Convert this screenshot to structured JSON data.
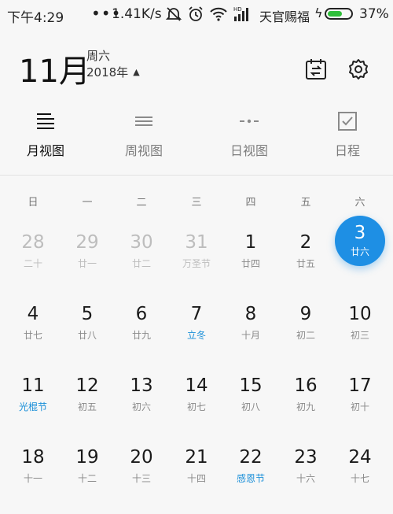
{
  "status_bar": {
    "time": "下午4:29",
    "dots": "•••",
    "net_speed": "1.41K/s",
    "carrier": "天官赐福",
    "battery_pct": "37%",
    "battery_level": 0.37,
    "icons": [
      "notification-muted-icon",
      "alarm-icon",
      "wifi-icon",
      "signal-icon",
      "charging-icon",
      "battery-icon"
    ]
  },
  "header": {
    "month": "11月",
    "weekday": "周六",
    "year": "2018年",
    "year_caret": "▲",
    "icons": [
      "calendar-switch-icon",
      "settings-gear-icon"
    ]
  },
  "tabs": [
    {
      "label": "月视图",
      "icon": "month-view-icon",
      "active": true
    },
    {
      "label": "周视图",
      "icon": "week-view-icon",
      "active": false
    },
    {
      "label": "日视图",
      "icon": "day-view-icon",
      "active": false
    },
    {
      "label": "日程",
      "icon": "schedule-checkbox-icon",
      "active": false
    }
  ],
  "weekdays": [
    "日",
    "一",
    "二",
    "三",
    "四",
    "五",
    "六"
  ],
  "weeks": [
    [
      {
        "num": "28",
        "lunar": "二十",
        "other": true
      },
      {
        "num": "29",
        "lunar": "廿一",
        "other": true
      },
      {
        "num": "30",
        "lunar": "廿二",
        "other": true
      },
      {
        "num": "31",
        "lunar": "万圣节",
        "other": true
      },
      {
        "num": "1",
        "lunar": "廿四"
      },
      {
        "num": "2",
        "lunar": "廿五"
      },
      {
        "num": "3",
        "lunar": "廿六",
        "selected": true
      }
    ],
    [
      {
        "num": "4",
        "lunar": "廿七"
      },
      {
        "num": "5",
        "lunar": "廿八"
      },
      {
        "num": "6",
        "lunar": "廿九"
      },
      {
        "num": "7",
        "lunar": "立冬",
        "festival": true
      },
      {
        "num": "8",
        "lunar": "十月"
      },
      {
        "num": "9",
        "lunar": "初二"
      },
      {
        "num": "10",
        "lunar": "初三"
      }
    ],
    [
      {
        "num": "11",
        "lunar": "光棍节",
        "festival": true
      },
      {
        "num": "12",
        "lunar": "初五"
      },
      {
        "num": "13",
        "lunar": "初六"
      },
      {
        "num": "14",
        "lunar": "初七"
      },
      {
        "num": "15",
        "lunar": "初八"
      },
      {
        "num": "16",
        "lunar": "初九"
      },
      {
        "num": "17",
        "lunar": "初十"
      }
    ],
    [
      {
        "num": "18",
        "lunar": "十一"
      },
      {
        "num": "19",
        "lunar": "十二"
      },
      {
        "num": "20",
        "lunar": "十三"
      },
      {
        "num": "21",
        "lunar": "十四"
      },
      {
        "num": "22",
        "lunar": "感恩节",
        "festival": true
      },
      {
        "num": "23",
        "lunar": "十六"
      },
      {
        "num": "24",
        "lunar": "十七"
      }
    ]
  ],
  "colors": {
    "accent": "#1e8fe4",
    "festival": "#1a8fd8",
    "battery": "#2fbf3a"
  }
}
